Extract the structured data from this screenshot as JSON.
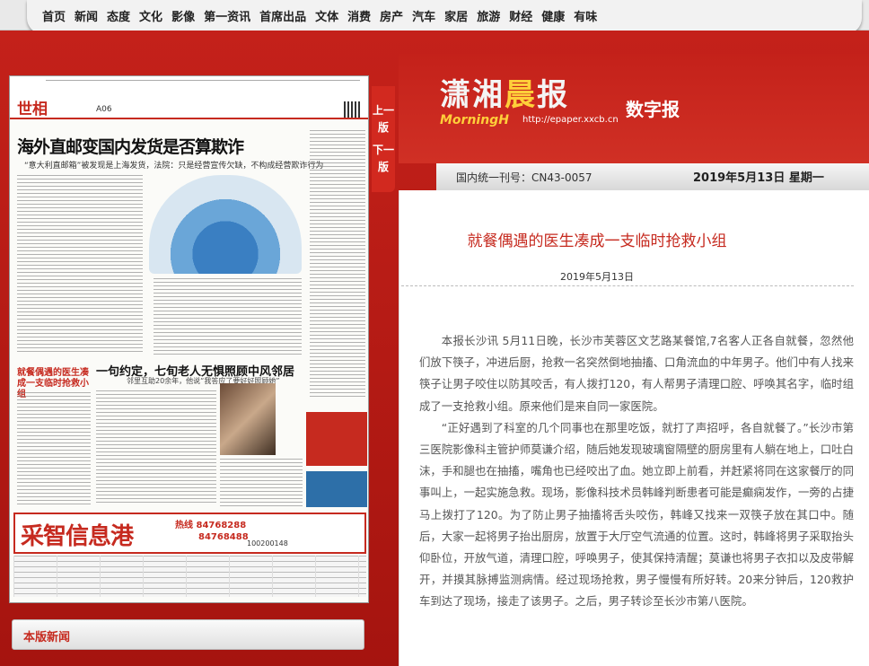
{
  "nav": {
    "items": [
      "首页",
      "新闻",
      "态度",
      "文化",
      "影像",
      "第一资讯",
      "首席出品",
      "文体",
      "消费",
      "房产",
      "汽车",
      "家居",
      "旅游",
      "财经",
      "健康",
      "有味"
    ]
  },
  "masthead": {
    "logo_a": "潇湘",
    "logo_b": "晨",
    "logo_c": "报",
    "logo_sub": "MorningH",
    "url": "http://epaper.xxcb.cn",
    "digital": "数字报"
  },
  "issue": {
    "cn": "国内统一刊号：CN43-0057",
    "date": "2019年5月13日 星期一"
  },
  "version_tabs": {
    "prev": "上一版",
    "next": "下一版"
  },
  "paper": {
    "section_tag": "世相",
    "page_no": "A06",
    "headline": "海外直邮变国内发货是否算欺诈",
    "subhead": "“意大利直邮箱”被发现是上海发货，法院：只是经营宣传欠缺，不构成经营欺诈行为",
    "side_title": "就餐偶遇的医生凑成一支临时抢救小组",
    "mid_headline": "一句约定，七旬老人无惧照顾中风邻居",
    "mid_sub": "邻里互助20余年，他说“我答应了要好好照顾她”",
    "ad_title": "采智信息港",
    "ad_phone_label": "热线",
    "ad_phone_1": "84768288",
    "ad_phone_2": "84768488",
    "ad_phone_3": "100200148"
  },
  "article": {
    "title": "就餐偶遇的医生凑成一支临时抢救小组",
    "date": "2019年5月13日",
    "p1": "本报长沙讯 5月11日晚，长沙市芙蓉区文艺路某餐馆,7名客人正各自就餐，忽然他们放下筷子，冲进后厨，抢救一名突然倒地抽搐、口角流血的中年男子。他们中有人找来筷子让男子咬住以防其咬舌，有人拨打120，有人帮男子清理口腔、呼唤其名字，临时组成了一支抢救小组。原来他们是来自同一家医院。",
    "p2": "“正好遇到了科室的几个同事也在那里吃饭，就打了声招呼，各自就餐了。”长沙市第三医院影像科主管护师莫谦介绍，随后她发现玻璃窗隔壁的厨房里有人躺在地上，口吐白沫，手和腿也在抽搐，嘴角也已经咬出了血。她立即上前看，并赶紧将同在这家餐厅的同事叫上，一起实施急救。现场，影像科技术员韩峰判断患者可能是癫痫发作，一旁的占捷马上拨打了120。为了防止男子抽搐将舌头咬伤，韩峰又找来一双筷子放在其口中。随后，大家一起将男子抬出厨房，放置于大厅空气流通的位置。这时，韩峰将男子采取抬头仰卧位，开放气道，清理口腔，呼唤男子，使其保持清醒；莫谦也将男子衣扣以及皮带解开，并摸其脉搏监测病情。经过现场抢救，男子慢慢有所好转。20来分钟后，120救护车到达了现场，接走了该男子。之后，男子转诊至长沙市第八医院。"
  },
  "sidebar": {
    "news_title": "本版新闻"
  }
}
